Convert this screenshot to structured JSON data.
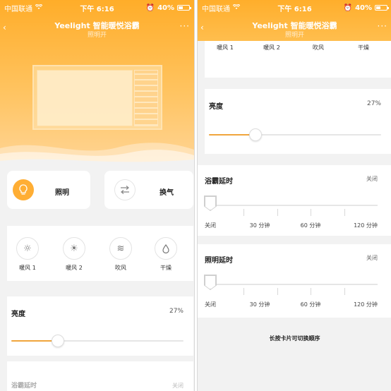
{
  "status": {
    "carrier": "中国联通",
    "time": "下午 6:16",
    "battery": "40%"
  },
  "header": {
    "title": "Yeelight 智能暖悦浴霸",
    "subtitle": "照明开"
  },
  "cards": {
    "light": {
      "label": "照明",
      "active": true
    },
    "vent": {
      "label": "换气",
      "active": false
    }
  },
  "modes": [
    {
      "label": "暖风 1",
      "icon": "sun-icon"
    },
    {
      "label": "暖风 2",
      "icon": "sun-icon"
    },
    {
      "label": "吹风",
      "icon": "wind-icon"
    },
    {
      "label": "干燥",
      "icon": "drop-icon"
    }
  ],
  "brightness": {
    "title": "亮度",
    "value": "27%",
    "level": 0.27
  },
  "bath_delay": {
    "title": "浴霸延时",
    "value": "关闭",
    "ticks": [
      "关闭",
      "30 分钟",
      "60 分钟",
      "120 分钟"
    ]
  },
  "light_delay": {
    "title": "照明延时",
    "value": "关闭",
    "ticks": [
      "关闭",
      "30 分钟",
      "60 分钟",
      "120 分钟"
    ]
  },
  "peek": {
    "title": "浴霸延时",
    "value": "关闭"
  },
  "hint": "长按卡片可切换顺序",
  "colors": {
    "accent": "#ffae34",
    "header_gradient_top": "#ffad29",
    "background": "#f2f2f2"
  }
}
